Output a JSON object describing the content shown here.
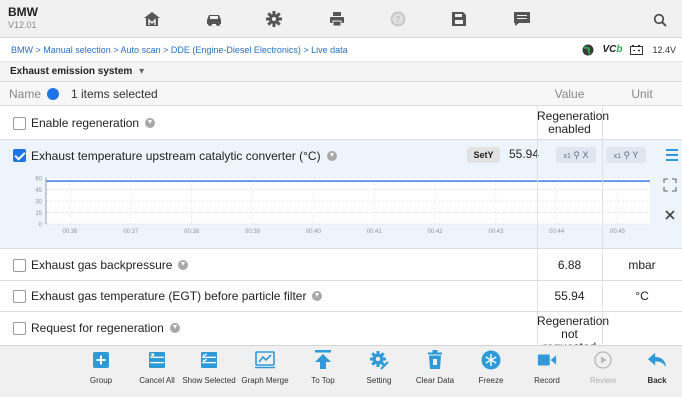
{
  "app": {
    "name": "BMW",
    "version": "V12.01"
  },
  "breadcrumb": "BMW > Manual selection > Auto scan > DDE (Engine-Diesel Electronics) > Live data",
  "status": {
    "vcb_prefix": "VC",
    "vcb_suffix": "b",
    "battery": "12.4V"
  },
  "section": {
    "label": "Exhaust emission system",
    "arrow": "▾"
  },
  "header": {
    "name": "Name",
    "selected": "1 items selected",
    "value": "Value",
    "unit": "Unit"
  },
  "rows": [
    {
      "label": "Enable regeneration",
      "value_line1": "Regeneration",
      "value_line2": "enabled",
      "unit": "",
      "checked": false
    },
    {
      "label": "Exhaust temperature upstream catalytic converter   (°C)",
      "value": "55.94",
      "checked": true
    },
    {
      "label": "Exhaust gas backpressure",
      "value": "6.88",
      "unit": "mbar",
      "checked": false
    },
    {
      "label": "Exhaust gas temperature (EGT) before particle filter",
      "value": "55.94",
      "unit": "°C",
      "checked": false
    },
    {
      "label": "Request for regeneration",
      "value_line1": "Regeneration",
      "value_line2": "not requested",
      "unit": "",
      "checked": false
    }
  ],
  "graph": {
    "setY_label": "SetY",
    "zoom_x_label": "×1 🔍X",
    "zoom_y_label": "×1 🔍Y",
    "zoom_x_mult": "x1",
    "zoom_y_mult": "x1",
    "zoom_x": "X",
    "zoom_y": "Y",
    "line_color": "#4a86e8"
  },
  "chart_data": {
    "type": "line",
    "y_ticks": [
      "60",
      "45",
      "30",
      "15",
      "0"
    ],
    "x_ticks": [
      "00:36",
      "00:37",
      "00:38",
      "00:39",
      "00:40",
      "00:41",
      "00:42",
      "00:43",
      "00:44",
      "00:45"
    ],
    "ylim": [
      0,
      60
    ],
    "series": [
      {
        "values": [
          55.94,
          55.94,
          55.94,
          55.94,
          55.94,
          55.94,
          55.94,
          55.94,
          55.94,
          55.94,
          55.94
        ]
      }
    ]
  },
  "toolbar": [
    {
      "label": "Group",
      "icon": "plus-box-icon",
      "enabled": true
    },
    {
      "label": "Cancel All",
      "icon": "checklist-cancel-icon",
      "enabled": true
    },
    {
      "label": "Show Selected",
      "icon": "checklist-selected-icon",
      "enabled": true
    },
    {
      "label": "Graph Merge",
      "icon": "graph-merge-icon",
      "enabled": true
    },
    {
      "label": "To Top",
      "icon": "to-top-icon",
      "enabled": true
    },
    {
      "label": "Setting",
      "icon": "setting-icon",
      "enabled": true
    },
    {
      "label": "Clear Data",
      "icon": "trash-icon",
      "enabled": true
    },
    {
      "label": "Freeze",
      "icon": "snowflake-icon",
      "enabled": true
    },
    {
      "label": "Record",
      "icon": "video-camera-icon",
      "enabled": true
    },
    {
      "label": "Review",
      "icon": "play-circle-icon",
      "enabled": false
    },
    {
      "label": "Back",
      "icon": "back-arrow-icon",
      "enabled": true
    }
  ],
  "colors": {
    "accent": "#1e73e8",
    "toolbar_icon": "#2e9ad8",
    "link": "#2a6fbf"
  }
}
